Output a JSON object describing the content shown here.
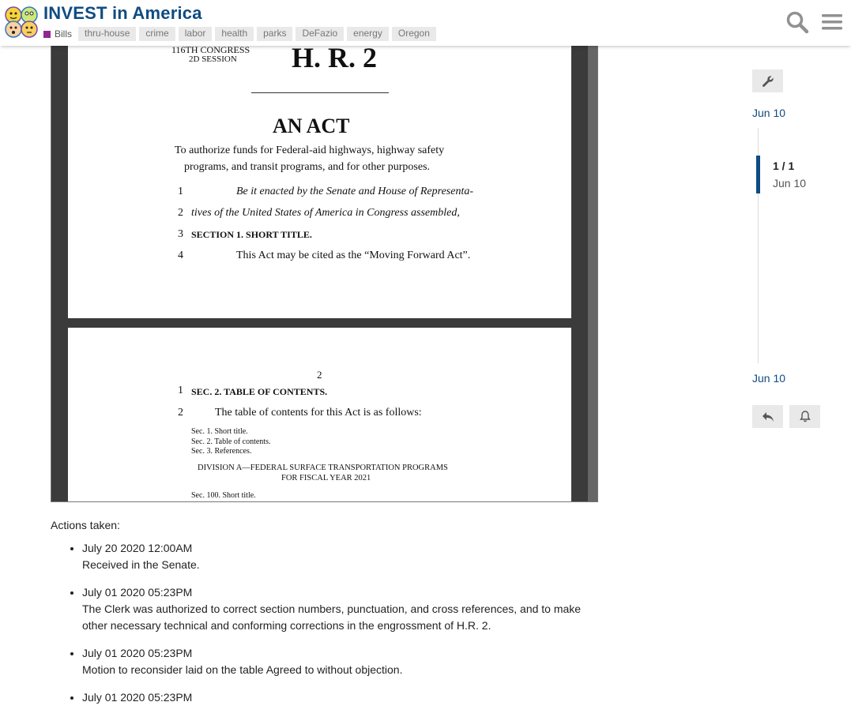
{
  "header": {
    "title": "INVEST in America",
    "category": "Bills",
    "category_color": "#92278f",
    "tags": [
      "thru-house",
      "crime",
      "labor",
      "health",
      "parks",
      "DeFazio",
      "energy",
      "Oregon"
    ],
    "icons": {
      "search": "search-icon",
      "menu": "hamburger-menu-icon"
    }
  },
  "pdf": {
    "page1": {
      "congress": "116TH CONGRESS",
      "session": "2D SESSION",
      "bill": "H. R. 2",
      "act": "AN ACT",
      "purpose1": "To authorize funds for Federal-aid highways, highway safety",
      "purpose2": "programs, and transit programs, and for other purposes.",
      "lines": [
        {
          "num": "1",
          "text": "Be it enacted by the Senate and House of Representa-"
        },
        {
          "num": "2",
          "text": "tives of the United States of America in Congress assembled,"
        },
        {
          "num": "3",
          "text": "SECTION 1. SHORT TITLE."
        },
        {
          "num": "4",
          "text": "This Act may be cited as the “Moving Forward Act”."
        }
      ]
    },
    "page2": {
      "page_num": "2",
      "lines": [
        {
          "num": "1",
          "text": "SEC. 2. TABLE OF CONTENTS."
        },
        {
          "num": "2",
          "text": "The table of contents for this Act is as follows:"
        }
      ],
      "toc": [
        "Sec. 1. Short title.",
        "Sec. 2. Table of contents.",
        "Sec. 3. References."
      ],
      "division1": "DIVISION A—FEDERAL SURFACE TRANSPORTATION PROGRAMS",
      "division2": "FOR FISCAL YEAR 2021",
      "toc_last": "Sec. 100. Short title."
    }
  },
  "actions": {
    "heading": "Actions taken:",
    "items": [
      {
        "date": "July 20 2020 12:00AM",
        "text": "Received in the Senate."
      },
      {
        "date": "July 01 2020 05:23PM",
        "text": "The Clerk was authorized to correct section numbers, punctuation, and cross references, and to make other necessary technical and conforming corrections in the engrossment of H.R. 2."
      },
      {
        "date": "July 01 2020 05:23PM",
        "text": "Motion to reconsider laid on the table Agreed to without objection."
      },
      {
        "date": "July 01 2020 05:23PM",
        "text": ""
      }
    ]
  },
  "timeline": {
    "top_date": "Jun 10",
    "position": "1 / 1",
    "position_date": "Jun 10",
    "bottom_date": "Jun 10",
    "accent": "#0f4c81",
    "icons": {
      "admin": "wrench-icon",
      "reply": "reply-icon",
      "notify": "bell-icon"
    }
  }
}
